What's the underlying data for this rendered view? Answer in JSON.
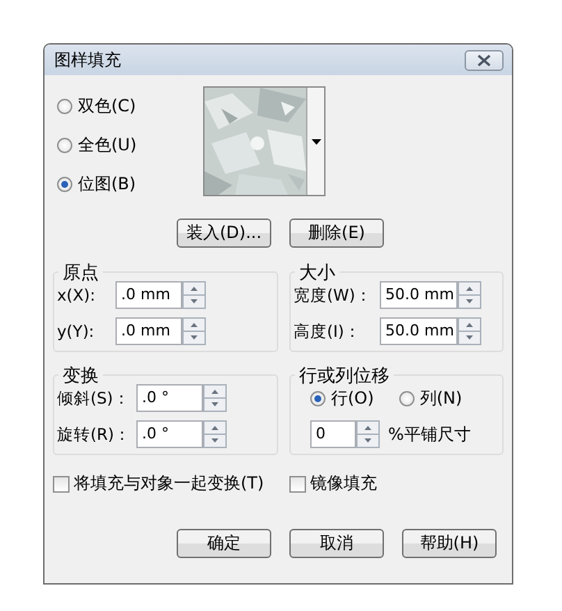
{
  "window": {
    "title": "图样填充"
  },
  "fill_types": [
    {
      "label": "双色(C)",
      "selected": false
    },
    {
      "label": "全色(U)",
      "selected": false
    },
    {
      "label": "位图(B)",
      "selected": true
    }
  ],
  "pattern_buttons": [
    "装入(D)...",
    "删除(E)"
  ],
  "origin": {
    "title": "原点",
    "fields": [
      {
        "label": "x(X):",
        "value": ".0 mm"
      },
      {
        "label": "y(Y):",
        "value": ".0 mm"
      }
    ]
  },
  "size": {
    "title": "大小",
    "fields": [
      {
        "label": "宽度(W)：",
        "value": "50.0 mm"
      },
      {
        "label": "高度(I)：",
        "value": "50.0 mm"
      }
    ]
  },
  "transform": {
    "title": "变换",
    "fields": [
      {
        "label": "倾斜(S)：",
        "value": ".0 °"
      },
      {
        "label": "旋转(R)：",
        "value": ".0 °"
      }
    ]
  },
  "offset": {
    "title": "行或列位移",
    "options": [
      {
        "label": "行(O)",
        "selected": true
      },
      {
        "label": "列(N)",
        "selected": false
      }
    ],
    "value": "0",
    "unit": "%平铺尺寸"
  },
  "checkboxes": [
    {
      "label": "将填充与对象一起变换(T)",
      "checked": false
    },
    {
      "label": "镜像填充",
      "checked": false
    }
  ],
  "buttons": [
    "确定",
    "取消",
    "帮助(H)"
  ]
}
